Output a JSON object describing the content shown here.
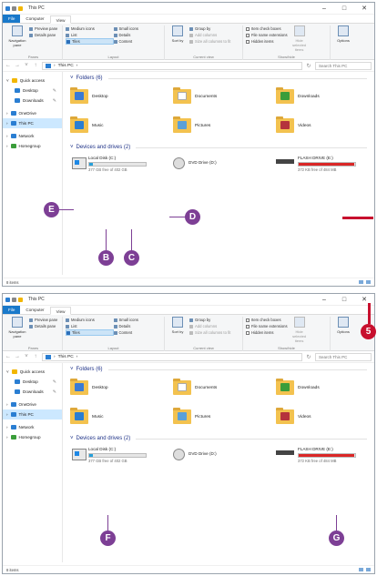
{
  "window_title": "This PC",
  "window_controls": {
    "minimize": "–",
    "maximize": "□",
    "close": "✕"
  },
  "ribbon_tabs": [
    "File",
    "Computer",
    "View"
  ],
  "ribbon": {
    "panes": {
      "navigation_pane": "Navigation pane",
      "preview_pane": "Preview pane",
      "details_pane": "Details pane",
      "label": "Panes"
    },
    "layout": {
      "medium_icons": "Medium icons",
      "small_icons": "Small icons",
      "list": "List",
      "details": "Details",
      "tiles": "Tiles",
      "content": "Content",
      "label": "Layout"
    },
    "current_view": {
      "sort_by": "Sort by",
      "group_by": "Group by",
      "add_columns": "Add columns",
      "size_all_columns": "Size all columns to fit",
      "label": "Current view"
    },
    "show_hide": {
      "item_check_boxes": "Item check boxes",
      "file_name_extensions": "File name extensions",
      "hidden_items": "Hidden items",
      "hide_selected": "Hide selected items",
      "label": "Show/hide"
    },
    "options": "Options"
  },
  "address": {
    "path": "This PC",
    "search_placeholder": "Search This PC"
  },
  "nav_items": [
    {
      "label": "Quick access",
      "level": 0,
      "color": "#f2b600"
    },
    {
      "label": "Desktop",
      "level": 1,
      "color": "#2a7ed2",
      "pinned": true
    },
    {
      "label": "Downloads",
      "level": 1,
      "color": "#2a7ed2",
      "pinned": true
    },
    {
      "label": "OneDrive",
      "level": 0,
      "color": "#2a7ed2"
    },
    {
      "label": "This PC",
      "level": 0,
      "color": "#2a7ed2"
    },
    {
      "label": "Network",
      "level": 0,
      "color": "#2a7ed2"
    },
    {
      "label": "Homegroup",
      "level": 0,
      "color": "#3a9d3a"
    }
  ],
  "folders_header": "Folders (6)",
  "folders": [
    {
      "label": "Desktop",
      "overlay": "#3a7bd5"
    },
    {
      "label": "Documents",
      "overlay": "#ffffff"
    },
    {
      "label": "Downloads",
      "overlay": "#3a9d3a"
    },
    {
      "label": "Music",
      "overlay": "#2a7ed2"
    },
    {
      "label": "Pictures",
      "overlay": "#5aa0d8"
    },
    {
      "label": "Videos",
      "overlay": "#b5323c"
    }
  ],
  "drives_header": "Devices and drives (2)",
  "drives": [
    {
      "name": "Local Disk (C:)",
      "free_text": "377 GB free of 402 GB",
      "used_fraction": 0.06,
      "bar_color": "#26a0da",
      "icon": "windows-drive-icon"
    },
    {
      "name": "DVD Drive (D:)",
      "free_text": "",
      "used_fraction": null,
      "bar_color": "",
      "icon": "dvd-drive-icon"
    },
    {
      "name": "FLASH DRIVE (E:)",
      "free_text": "372 KB free of 484 MB",
      "used_fraction": 0.99,
      "bar_color": "#da2626",
      "icon": "usb-drive-icon"
    }
  ],
  "status_text": "8 items",
  "callouts": {
    "b": "B",
    "c": "C",
    "d": "D",
    "e": "E",
    "f": "F",
    "g": "G",
    "five": "5"
  },
  "colors": {
    "accent": "#1979ca",
    "callout_purple": "#7d3f95",
    "callout_red": "#c8102e"
  }
}
